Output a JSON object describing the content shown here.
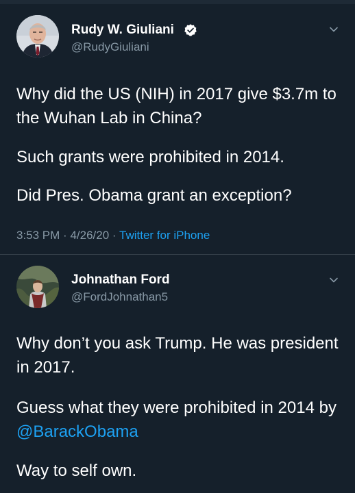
{
  "tweets": [
    {
      "name": "Rudy W. Giuliani",
      "handle": "@RudyGiuliani",
      "verified": true,
      "paragraphs": [
        "Why did the US (NIH) in 2017 give $3.7m to the Wuhan Lab in China?",
        "Such grants were prohibited in 2014.",
        "Did Pres. Obama grant an exception?"
      ],
      "time": "3:53 PM",
      "date": "4/26/20",
      "separator": "·",
      "source": "Twitter for iPhone"
    },
    {
      "name": "Johnathan Ford",
      "handle": "@FordJohnathan5",
      "verified": false,
      "paragraphs": [
        "Why don’t you ask Trump. He was president in 2017.",
        "Guess what they were prohibited in 2014 by ",
        "Way to self own."
      ],
      "mention": "@BarackObama"
    }
  ],
  "colors": {
    "background": "#15202b",
    "text": "#ffffff",
    "muted": "#8899a6",
    "accent": "#1da1f2",
    "divider": "#38444d"
  },
  "icons": {
    "verified": "verified-badge-icon",
    "menu": "chevron-down-icon"
  }
}
